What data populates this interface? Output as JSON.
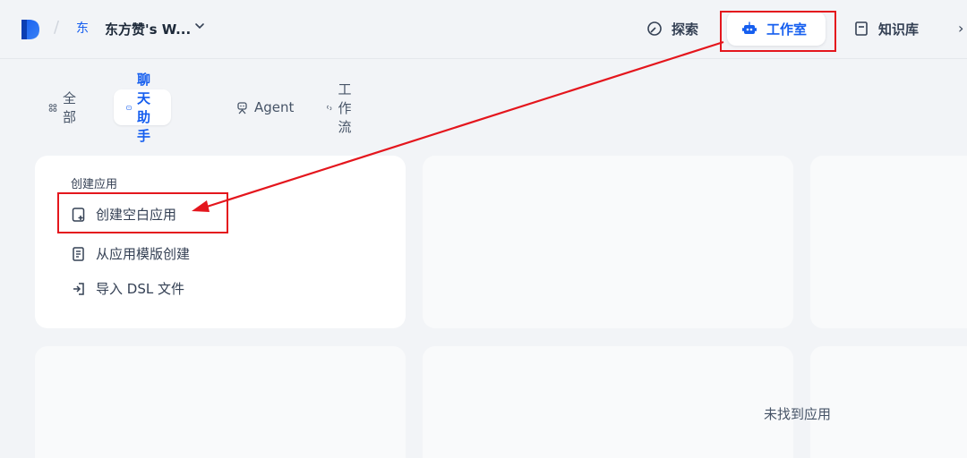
{
  "header": {
    "workspace_avatar": "东",
    "workspace_name": "东方赞's W...",
    "nav": [
      {
        "label": "探索",
        "icon": "compass-icon"
      },
      {
        "label": "工作室",
        "icon": "robot-icon",
        "active": true
      },
      {
        "label": "知识库",
        "icon": "book-icon"
      }
    ]
  },
  "tabs": [
    {
      "label": "全部",
      "icon": "grid-icon"
    },
    {
      "label": "聊天助手",
      "icon": "chat-bot-icon",
      "active": true
    },
    {
      "label": "Agent",
      "icon": "agent-icon"
    },
    {
      "label": "工作流",
      "icon": "workflow-icon"
    }
  ],
  "create_card": {
    "title": "创建应用",
    "items": [
      {
        "label": "创建空白应用",
        "icon": "file-plus-icon"
      },
      {
        "label": "从应用模版创建",
        "icon": "template-icon"
      },
      {
        "label": "导入 DSL 文件",
        "icon": "import-icon"
      }
    ]
  },
  "empty_state": "未找到应用",
  "colors": {
    "accent": "#155eef",
    "annotation": "#e4161d",
    "background": "#f2f4f7"
  }
}
